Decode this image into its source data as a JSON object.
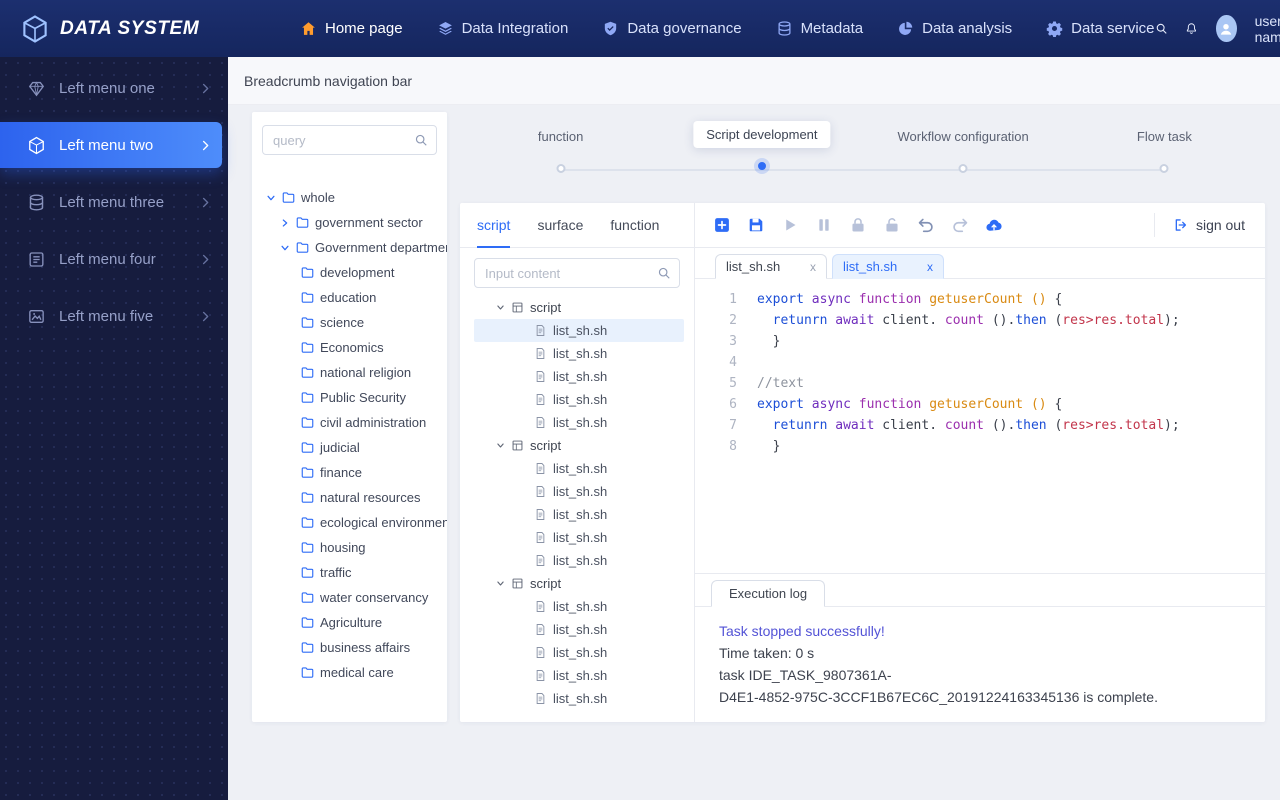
{
  "colors": {
    "primary": "#2e6cf6",
    "topbar_bg": "#182a66",
    "sidebar_bg": "#161c3e",
    "home_icon_orange": "#ff9c2e",
    "log_accent": "#5353d6",
    "selected_row_bg": "#e8f1fd"
  },
  "topbar": {
    "logo_text": "DATA SYSTEM",
    "logo_icon": "cube-logo-icon",
    "nav": [
      {
        "label": "Home page",
        "icon": "home-icon",
        "active": true
      },
      {
        "label": "Data Integration",
        "icon": "data-integration-icon"
      },
      {
        "label": "Data governance",
        "icon": "data-governance-icon"
      },
      {
        "label": "Metadata",
        "icon": "metadata-icon"
      },
      {
        "label": "Data analysis",
        "icon": "data-analysis-icon"
      },
      {
        "label": "Data service",
        "icon": "data-service-icon"
      }
    ],
    "search_icon": "search-icon",
    "bell_icon": "bell-icon",
    "user_name": "user name"
  },
  "sidebar": {
    "items": [
      {
        "label": "Left menu one",
        "icon": "gem-icon"
      },
      {
        "label": "Left menu two",
        "icon": "cube-icon",
        "active": true
      },
      {
        "label": "Left menu three",
        "icon": "database-icon"
      },
      {
        "label": "Left menu four",
        "icon": "form-icon"
      },
      {
        "label": "Left menu five",
        "icon": "image-icon"
      }
    ]
  },
  "breadcrumb": {
    "label": "Breadcrumb navigation bar"
  },
  "catalog_panel": {
    "search_placeholder": "query",
    "search_icon": "search-icon",
    "tree": [
      {
        "label": "whole",
        "level": 0,
        "caret": "down"
      },
      {
        "label": "government sector",
        "level": 1,
        "caret": "right"
      },
      {
        "label": "Government departments",
        "level": 1,
        "caret": "down"
      },
      {
        "label": "development",
        "level": 2,
        "caret": "none"
      },
      {
        "label": "education",
        "level": 2,
        "caret": "none"
      },
      {
        "label": "science",
        "level": 2,
        "caret": "none"
      },
      {
        "label": "Economics",
        "level": 2,
        "caret": "none"
      },
      {
        "label": "national religion",
        "level": 2,
        "caret": "none"
      },
      {
        "label": "Public Security",
        "level": 2,
        "caret": "none"
      },
      {
        "label": "civil administration",
        "level": 2,
        "caret": "none"
      },
      {
        "label": "judicial",
        "level": 2,
        "caret": "none"
      },
      {
        "label": "finance",
        "level": 2,
        "caret": "none"
      },
      {
        "label": "natural resources",
        "level": 2,
        "caret": "none"
      },
      {
        "label": "ecological environment",
        "level": 2,
        "caret": "none"
      },
      {
        "label": "housing",
        "level": 2,
        "caret": "none"
      },
      {
        "label": "traffic",
        "level": 2,
        "caret": "none"
      },
      {
        "label": "water conservancy",
        "level": 2,
        "caret": "none"
      },
      {
        "label": "Agriculture",
        "level": 2,
        "caret": "none"
      },
      {
        "label": "business affairs",
        "level": 2,
        "caret": "none"
      },
      {
        "label": "medical care",
        "level": 2,
        "caret": "none"
      }
    ]
  },
  "stepper": {
    "steps": [
      {
        "label": "function"
      },
      {
        "label": "Script development",
        "active": true
      },
      {
        "label": "Workflow configuration"
      },
      {
        "label": "Flow task"
      }
    ]
  },
  "workspace": {
    "tabs": [
      {
        "label": "script",
        "active": true
      },
      {
        "label": "surface"
      },
      {
        "label": "function"
      }
    ],
    "file_search_placeholder": "Input content",
    "file_tree": [
      {
        "label": "script",
        "kind": "group"
      },
      {
        "label": "list_sh.sh",
        "kind": "file",
        "selected": true
      },
      {
        "label": "list_sh.sh",
        "kind": "file"
      },
      {
        "label": "list_sh.sh",
        "kind": "file"
      },
      {
        "label": "list_sh.sh",
        "kind": "file"
      },
      {
        "label": "list_sh.sh",
        "kind": "file"
      },
      {
        "label": "script",
        "kind": "group"
      },
      {
        "label": "list_sh.sh",
        "kind": "file"
      },
      {
        "label": "list_sh.sh",
        "kind": "file"
      },
      {
        "label": "list_sh.sh",
        "kind": "file"
      },
      {
        "label": "list_sh.sh",
        "kind": "file"
      },
      {
        "label": "list_sh.sh",
        "kind": "file"
      },
      {
        "label": "script",
        "kind": "group"
      },
      {
        "label": "list_sh.sh",
        "kind": "file"
      },
      {
        "label": "list_sh.sh",
        "kind": "file"
      },
      {
        "label": "list_sh.sh",
        "kind": "file"
      },
      {
        "label": "list_sh.sh",
        "kind": "file"
      },
      {
        "label": "list_sh.sh",
        "kind": "file"
      }
    ]
  },
  "editor": {
    "toolbar": [
      {
        "name": "new-file-icon",
        "tone": "blue"
      },
      {
        "name": "save-icon",
        "tone": "blue"
      },
      {
        "name": "run-icon",
        "tone": "gray"
      },
      {
        "name": "pause-icon",
        "tone": "gray"
      },
      {
        "name": "lock-icon",
        "tone": "gray"
      },
      {
        "name": "unlock-icon",
        "tone": "gray"
      },
      {
        "name": "undo-icon",
        "tone": "slate"
      },
      {
        "name": "redo-icon",
        "tone": "gray"
      },
      {
        "name": "upload-cloud-icon",
        "tone": "blue"
      }
    ],
    "signout_label": "sign out",
    "signout_icon": "signout-icon",
    "tabs": [
      {
        "label": "list_sh.sh",
        "close": "x"
      },
      {
        "label": "list_sh.sh",
        "close": "x",
        "active": true
      }
    ],
    "code": [
      {
        "n": 1,
        "tokens": [
          {
            "t": "export ",
            "c": "blue"
          },
          {
            "t": "async ",
            "c": "purple"
          },
          {
            "t": "function ",
            "c": "magenta"
          },
          {
            "t": "getuserCount ",
            "c": "orange"
          },
          {
            "t": "() ",
            "c": "orange"
          },
          {
            "t": "{",
            "c": "plain"
          }
        ]
      },
      {
        "n": 2,
        "tokens": [
          {
            "t": "  ",
            "c": "plain"
          },
          {
            "t": "retunrn ",
            "c": "blue"
          },
          {
            "t": "await ",
            "c": "purple"
          },
          {
            "t": "client. ",
            "c": "plain"
          },
          {
            "t": "count ",
            "c": "magenta"
          },
          {
            "t": "().",
            "c": "plain"
          },
          {
            "t": "then ",
            "c": "blue"
          },
          {
            "t": "(",
            "c": "plain"
          },
          {
            "t": "res>res.total",
            "c": "red"
          },
          {
            "t": ");",
            "c": "plain"
          }
        ]
      },
      {
        "n": 3,
        "tokens": [
          {
            "t": "  }",
            "c": "plain"
          }
        ]
      },
      {
        "n": 4,
        "tokens": []
      },
      {
        "n": 5,
        "tokens": [
          {
            "t": "//text",
            "c": "comment"
          }
        ]
      },
      {
        "n": 6,
        "tokens": [
          {
            "t": "export ",
            "c": "blue"
          },
          {
            "t": "async ",
            "c": "purple"
          },
          {
            "t": "function ",
            "c": "magenta"
          },
          {
            "t": "getuserCount ",
            "c": "orange"
          },
          {
            "t": "() ",
            "c": "orange"
          },
          {
            "t": "{",
            "c": "plain"
          }
        ]
      },
      {
        "n": 7,
        "tokens": [
          {
            "t": "  ",
            "c": "plain"
          },
          {
            "t": "retunrn ",
            "c": "blue"
          },
          {
            "t": "await ",
            "c": "purple"
          },
          {
            "t": "client. ",
            "c": "plain"
          },
          {
            "t": "count ",
            "c": "magenta"
          },
          {
            "t": "().",
            "c": "plain"
          },
          {
            "t": "then ",
            "c": "blue"
          },
          {
            "t": "(",
            "c": "plain"
          },
          {
            "t": "res>res.total",
            "c": "red"
          },
          {
            "t": ");",
            "c": "plain"
          }
        ]
      },
      {
        "n": 8,
        "tokens": [
          {
            "t": "  }",
            "c": "plain"
          }
        ]
      }
    ]
  },
  "log": {
    "tab_label": "Execution log",
    "lines": [
      {
        "text": "Task stopped successfully!",
        "accent": true
      },
      {
        "text": "Time taken: 0 s"
      },
      {
        "text": "task IDE_TASK_9807361A-"
      },
      {
        "text": "D4E1-4852-975C-3CCF1B67EC6C_20191224163345136 is complete."
      }
    ]
  }
}
